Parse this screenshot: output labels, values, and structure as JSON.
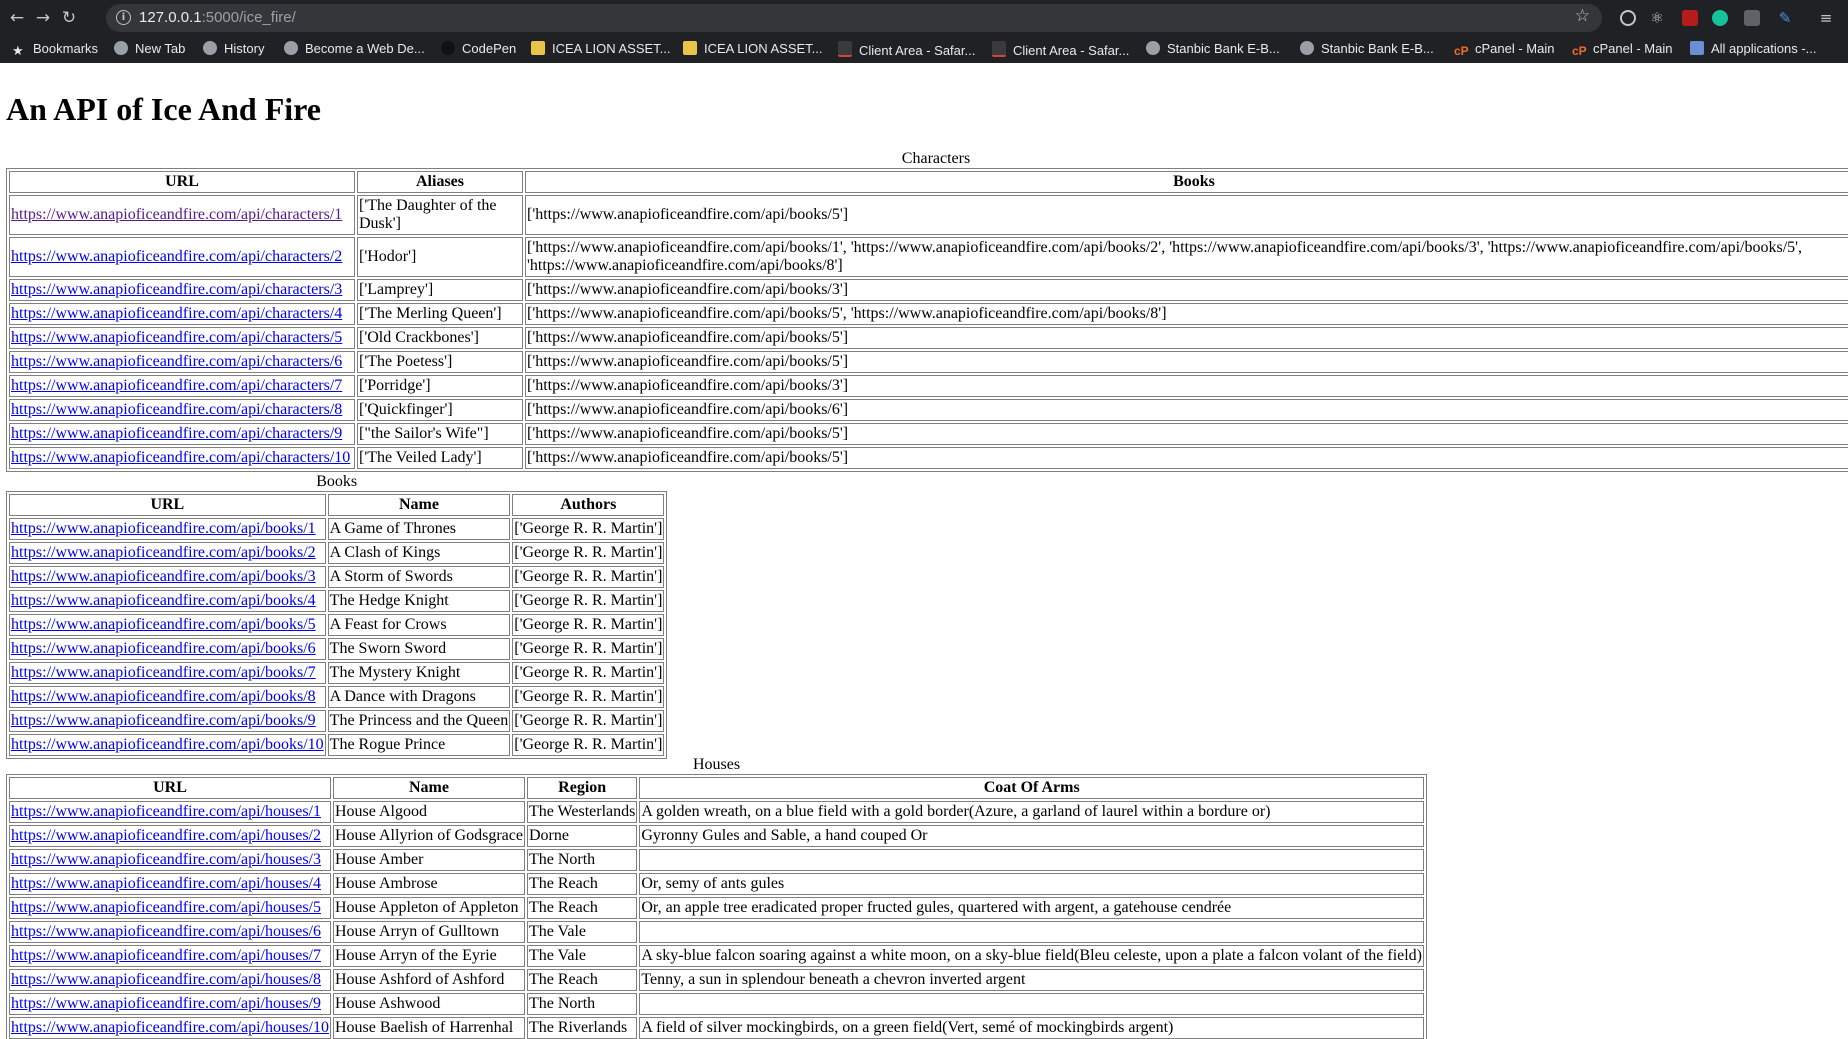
{
  "browser": {
    "url_host": "127.0.0.1",
    "url_rest": ":5000/ice_fire/",
    "bookmarks": [
      "Bookmarks",
      "New Tab",
      "History",
      "Become a Web De...",
      "CodePen",
      "ICEA LION ASSET...",
      "ICEA LION ASSET...",
      "Client Area - Safar...",
      "Client Area - Safar...",
      "Stanbic Bank E-B...",
      "Stanbic Bank E-B...",
      "cPanel - Main",
      "cPanel - Main",
      "All applications -..."
    ]
  },
  "page": {
    "title": "An API of Ice And Fire"
  },
  "characters": {
    "caption": "Characters",
    "headers": [
      "URL",
      "Aliases",
      "Books"
    ],
    "rows": [
      [
        "https://www.anapioficeandfire.com/api/characters/1",
        "['The Daughter of the Dusk']",
        "['https://www.anapioficeandfire.com/api/books/5']"
      ],
      [
        "https://www.anapioficeandfire.com/api/characters/2",
        "['Hodor']",
        "['https://www.anapioficeandfire.com/api/books/1', 'https://www.anapioficeandfire.com/api/books/2', 'https://www.anapioficeandfire.com/api/books/3', 'https://www.anapioficeandfire.com/api/books/5', 'https://www.anapioficeandfire.com/api/books/8']"
      ],
      [
        "https://www.anapioficeandfire.com/api/characters/3",
        "['Lamprey']",
        "['https://www.anapioficeandfire.com/api/books/3']"
      ],
      [
        "https://www.anapioficeandfire.com/api/characters/4",
        "['The Merling Queen']",
        "['https://www.anapioficeandfire.com/api/books/5', 'https://www.anapioficeandfire.com/api/books/8']"
      ],
      [
        "https://www.anapioficeandfire.com/api/characters/5",
        "['Old Crackbones']",
        "['https://www.anapioficeandfire.com/api/books/5']"
      ],
      [
        "https://www.anapioficeandfire.com/api/characters/6",
        "['The Poetess']",
        "['https://www.anapioficeandfire.com/api/books/5']"
      ],
      [
        "https://www.anapioficeandfire.com/api/characters/7",
        "['Porridge']",
        "['https://www.anapioficeandfire.com/api/books/3']"
      ],
      [
        "https://www.anapioficeandfire.com/api/characters/8",
        "['Quickfinger']",
        "['https://www.anapioficeandfire.com/api/books/6']"
      ],
      [
        "https://www.anapioficeandfire.com/api/characters/9",
        "[\"the Sailor's Wife\"]",
        "['https://www.anapioficeandfire.com/api/books/5']"
      ],
      [
        "https://www.anapioficeandfire.com/api/characters/10",
        "['The Veiled Lady']",
        "['https://www.anapioficeandfire.com/api/books/5']"
      ]
    ]
  },
  "books": {
    "caption": "Books",
    "headers": [
      "URL",
      "Name",
      "Authors"
    ],
    "rows": [
      [
        "https://www.anapioficeandfire.com/api/books/1",
        "A Game of Thrones",
        "['George R. R. Martin']"
      ],
      [
        "https://www.anapioficeandfire.com/api/books/2",
        "A Clash of Kings",
        "['George R. R. Martin']"
      ],
      [
        "https://www.anapioficeandfire.com/api/books/3",
        "A Storm of Swords",
        "['George R. R. Martin']"
      ],
      [
        "https://www.anapioficeandfire.com/api/books/4",
        "The Hedge Knight",
        "['George R. R. Martin']"
      ],
      [
        "https://www.anapioficeandfire.com/api/books/5",
        "A Feast for Crows",
        "['George R. R. Martin']"
      ],
      [
        "https://www.anapioficeandfire.com/api/books/6",
        "The Sworn Sword",
        "['George R. R. Martin']"
      ],
      [
        "https://www.anapioficeandfire.com/api/books/7",
        "The Mystery Knight",
        "['George R. R. Martin']"
      ],
      [
        "https://www.anapioficeandfire.com/api/books/8",
        "A Dance with Dragons",
        "['George R. R. Martin']"
      ],
      [
        "https://www.anapioficeandfire.com/api/books/9",
        "The Princess and the Queen",
        "['George R. R. Martin']"
      ],
      [
        "https://www.anapioficeandfire.com/api/books/10",
        "The Rogue Prince",
        "['George R. R. Martin']"
      ]
    ]
  },
  "houses": {
    "caption": "Houses",
    "headers": [
      "URL",
      "Name",
      "Region",
      "Coat Of Arms"
    ],
    "rows": [
      [
        "https://www.anapioficeandfire.com/api/houses/1",
        "House Algood",
        "The Westerlands",
        "A golden wreath, on a blue field with a gold border(Azure, a garland of laurel within a bordure or)"
      ],
      [
        "https://www.anapioficeandfire.com/api/houses/2",
        "House Allyrion of Godsgrace",
        "Dorne",
        "Gyronny Gules and Sable, a hand couped Or"
      ],
      [
        "https://www.anapioficeandfire.com/api/houses/3",
        "House Amber",
        "The North",
        ""
      ],
      [
        "https://www.anapioficeandfire.com/api/houses/4",
        "House Ambrose",
        "The Reach",
        "Or, semy of ants gules"
      ],
      [
        "https://www.anapioficeandfire.com/api/houses/5",
        "House Appleton of Appleton",
        "The Reach",
        "Or, an apple tree eradicated proper fructed gules, quartered with argent, a gatehouse cendrée"
      ],
      [
        "https://www.anapioficeandfire.com/api/houses/6",
        "House Arryn of Gulltown",
        "The Vale",
        ""
      ],
      [
        "https://www.anapioficeandfire.com/api/houses/7",
        "House Arryn of the Eyrie",
        "The Vale",
        "A sky-blue falcon soaring against a white moon, on a sky-blue field(Bleu celeste, upon a plate a falcon volant of the field)"
      ],
      [
        "https://www.anapioficeandfire.com/api/houses/8",
        "House Ashford of Ashford",
        "The Reach",
        "Tenny, a sun in splendour beneath a chevron inverted argent"
      ],
      [
        "https://www.anapioficeandfire.com/api/houses/9",
        "House Ashwood",
        "The North",
        ""
      ],
      [
        "https://www.anapioficeandfire.com/api/houses/10",
        "House Baelish of Harrenhal",
        "The Riverlands",
        "A field of silver mockingbirds, on a green field(Vert, semé of mockingbirds argent)"
      ]
    ]
  },
  "colors": {
    "link": "#0000ee",
    "visited_link": "#551a8b",
    "chrome_bg": "#202124"
  }
}
